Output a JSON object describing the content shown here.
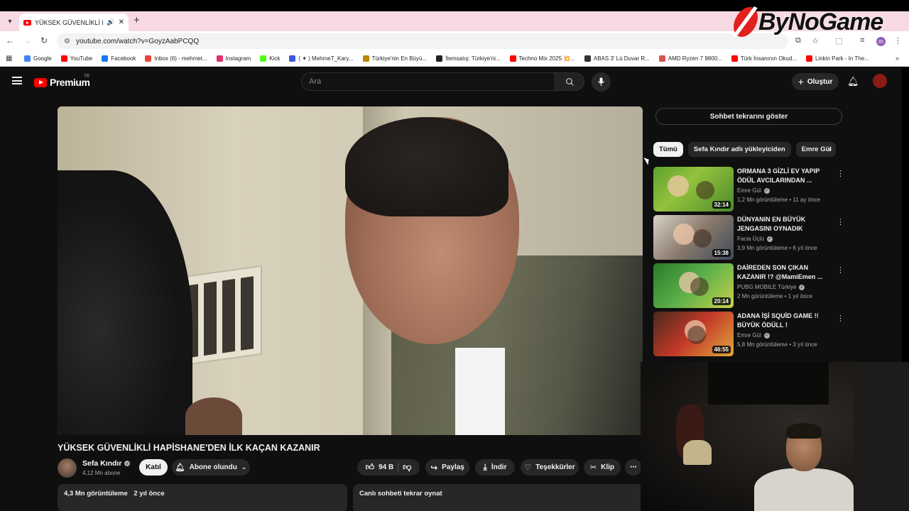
{
  "browser": {
    "tab_title": "YÜKSEK GÜVENLİKLİ HAPİS",
    "url": "youtube.com/watch?v=GoyzAabPCQQ",
    "profile_initial": "m",
    "bookmarks": [
      {
        "label": "Google",
        "color": "#4285f4"
      },
      {
        "label": "YouTube",
        "color": "#ff0000"
      },
      {
        "label": "Facebook",
        "color": "#1877f2"
      },
      {
        "label": "Inbox (6) - mehmet...",
        "color": "#ea4335"
      },
      {
        "label": "Instagram",
        "color": "#e1306c"
      },
      {
        "label": "Kick",
        "color": "#53fc18"
      },
      {
        "label": "( ✦ ) MehmeT_Kary...",
        "color": "#3b5bdb"
      },
      {
        "label": "Türkiye'nin En Büyü...",
        "color": "#b8860b"
      },
      {
        "label": "İtemsatış: Türkiye'ni...",
        "color": "#222222"
      },
      {
        "label": "Techno Mix 2025 💥...",
        "color": "#ff0000"
      },
      {
        "label": "ABAS 3' Lü Duvar R...",
        "color": "#333333"
      },
      {
        "label": "AMD Ryzen 7 9800...",
        "color": "#d9534f"
      },
      {
        "label": "Türk İnsanının Okud...",
        "color": "#ff0000"
      },
      {
        "label": "Linkin Park - In The...",
        "color": "#ff0000"
      }
    ]
  },
  "overlay": {
    "logo_text": "ByNoGame"
  },
  "youtube": {
    "logo_text": "Premium",
    "region": "TR",
    "search_placeholder": "Ara",
    "create_label": "Oluştur",
    "video": {
      "title": "YÜKSEK GÜVENLİKLİ HAPİSHANE'DEN İLK KAÇAN KAZANIR",
      "channel": "Sefa Kındır",
      "subscribers": "4,12 Mn abone",
      "join_label": "Katıl",
      "subscribed_label": "Abone olundu",
      "likes": "94 B",
      "share_label": "Paylaş",
      "download_label": "İndir",
      "thanks_label": "Teşekkürler",
      "clip_label": "Klip",
      "views_text": "4,3 Mn görüntüleme",
      "age_text": "2 yıl önce",
      "live_chat_replay": "Canlı sohbeti tekrar oynat"
    },
    "sidebar": {
      "chat_replay_button": "Sohbet tekrarını göster",
      "chips": [
        "Tümü",
        "Sefa Kındır adlı yükleyiciden",
        "Emre Gül"
      ],
      "recommendations": [
        {
          "title": "ORMANA 3 GİZLİ EV YAPIP ÖDÜL AVCILARINDAN ...",
          "channel": "Emre Gül",
          "meta": "1,2 Mn görüntüleme • 11 ay önce",
          "duration": "32:14"
        },
        {
          "title": "DÜNYANIN EN BÜYÜK JENGASINI OYNADIK",
          "channel": "Facia Üçlü",
          "meta": "3,9 Mn görüntüleme • 6 yıl önce",
          "duration": "15:38"
        },
        {
          "title": "DAİREDEN SON ÇIKAN KAZANIR !? @MamiEmen ...",
          "channel": "PUBG MOBILE Türkiye",
          "meta": "2 Mn görüntüleme • 1 yıl önce",
          "duration": "20:14"
        },
        {
          "title": "ADANA İŞİ SQUİD GAME !! BÜYÜK ÖDÜLL !",
          "channel": "Emre Gül",
          "meta": "5,8 Mn görüntüleme • 3 yıl önce",
          "duration": "46:55"
        }
      ]
    }
  }
}
